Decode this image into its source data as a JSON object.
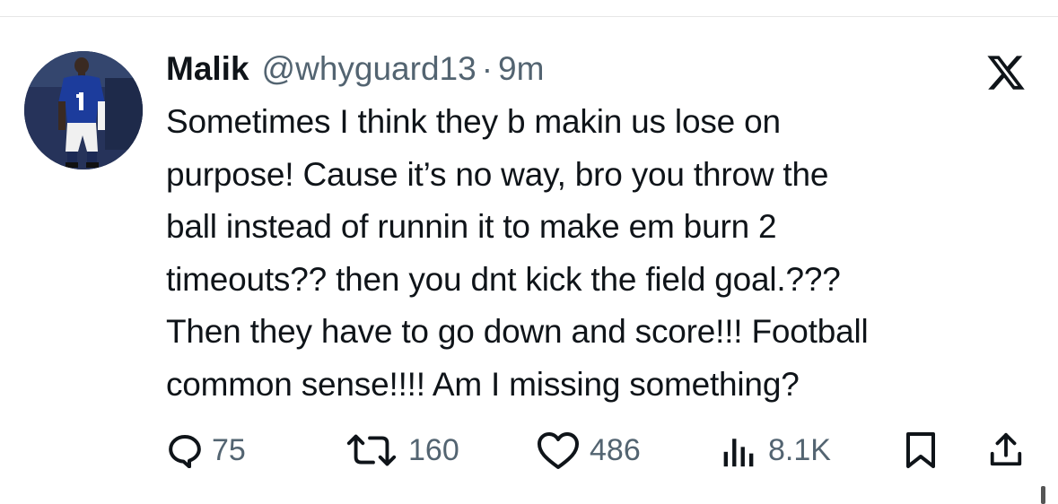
{
  "tweet": {
    "author_name": "Malik",
    "handle": "@whyguard13",
    "separator": "·",
    "time": "9m",
    "text": "Sometimes I think they b makin us lose on\npurpose! Cause it’s no way, bro you throw the\nball instead of runnin it to make em burn 2\ntimeouts?? then you dnt kick the field goal.???\nThen they have to go down and score!!! Football\ncommon sense!!!! Am I missing something?",
    "avatar_icon": "player-avatar",
    "platform_icon": "x-logo-icon"
  },
  "actions": {
    "replies": {
      "icon": "reply-icon",
      "count": "75"
    },
    "reposts": {
      "icon": "repost-icon",
      "count": "160"
    },
    "likes": {
      "icon": "heart-icon",
      "count": "486"
    },
    "views": {
      "icon": "views-chart-icon",
      "count": "8.1K"
    },
    "bookmark": {
      "icon": "bookmark-icon"
    },
    "share": {
      "icon": "share-icon"
    }
  },
  "colors": {
    "text_primary": "#0f1419",
    "text_secondary": "#536471",
    "background": "#ffffff"
  }
}
